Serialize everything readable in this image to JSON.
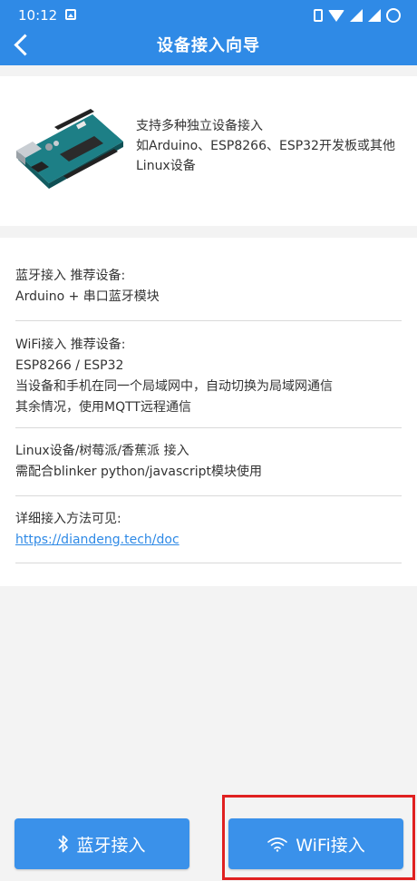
{
  "status_bar": {
    "time": "10:12"
  },
  "app_bar": {
    "title": "设备接入向导"
  },
  "intro": {
    "lines": [
      "支持多种独立设备接入",
      "如Arduino、ESP8266、ESP32开发板或其他",
      "Linux设备"
    ]
  },
  "info": {
    "bluetooth": {
      "line1": "蓝牙接入 推荐设备:",
      "line2": "Arduino + 串口蓝牙模块"
    },
    "wifi": {
      "line1": "WiFi接入 推荐设备:",
      "line2": "ESP8266 / ESP32",
      "line3": "当设备和手机在同一个局域网中，自动切换为局域网通信",
      "line4": "其余情况，使用MQTT远程通信"
    },
    "linux": {
      "line1": "Linux设备/树莓派/香蕉派 接入",
      "line2": "需配合blinker python/javascript模块使用"
    },
    "docs": {
      "line1": "详细接入方法可见:",
      "link": "https://diandeng.tech/doc"
    }
  },
  "buttons": {
    "bluetooth_label": "蓝牙接入",
    "wifi_label": "WiFi接入"
  },
  "colors": {
    "primary": "#2f8ae6",
    "button": "#3a91ea",
    "highlight": "#e02020"
  },
  "icons": {
    "back": "chevron-left-icon",
    "bluetooth": "bluetooth-icon",
    "wifi": "wifi-icon"
  }
}
